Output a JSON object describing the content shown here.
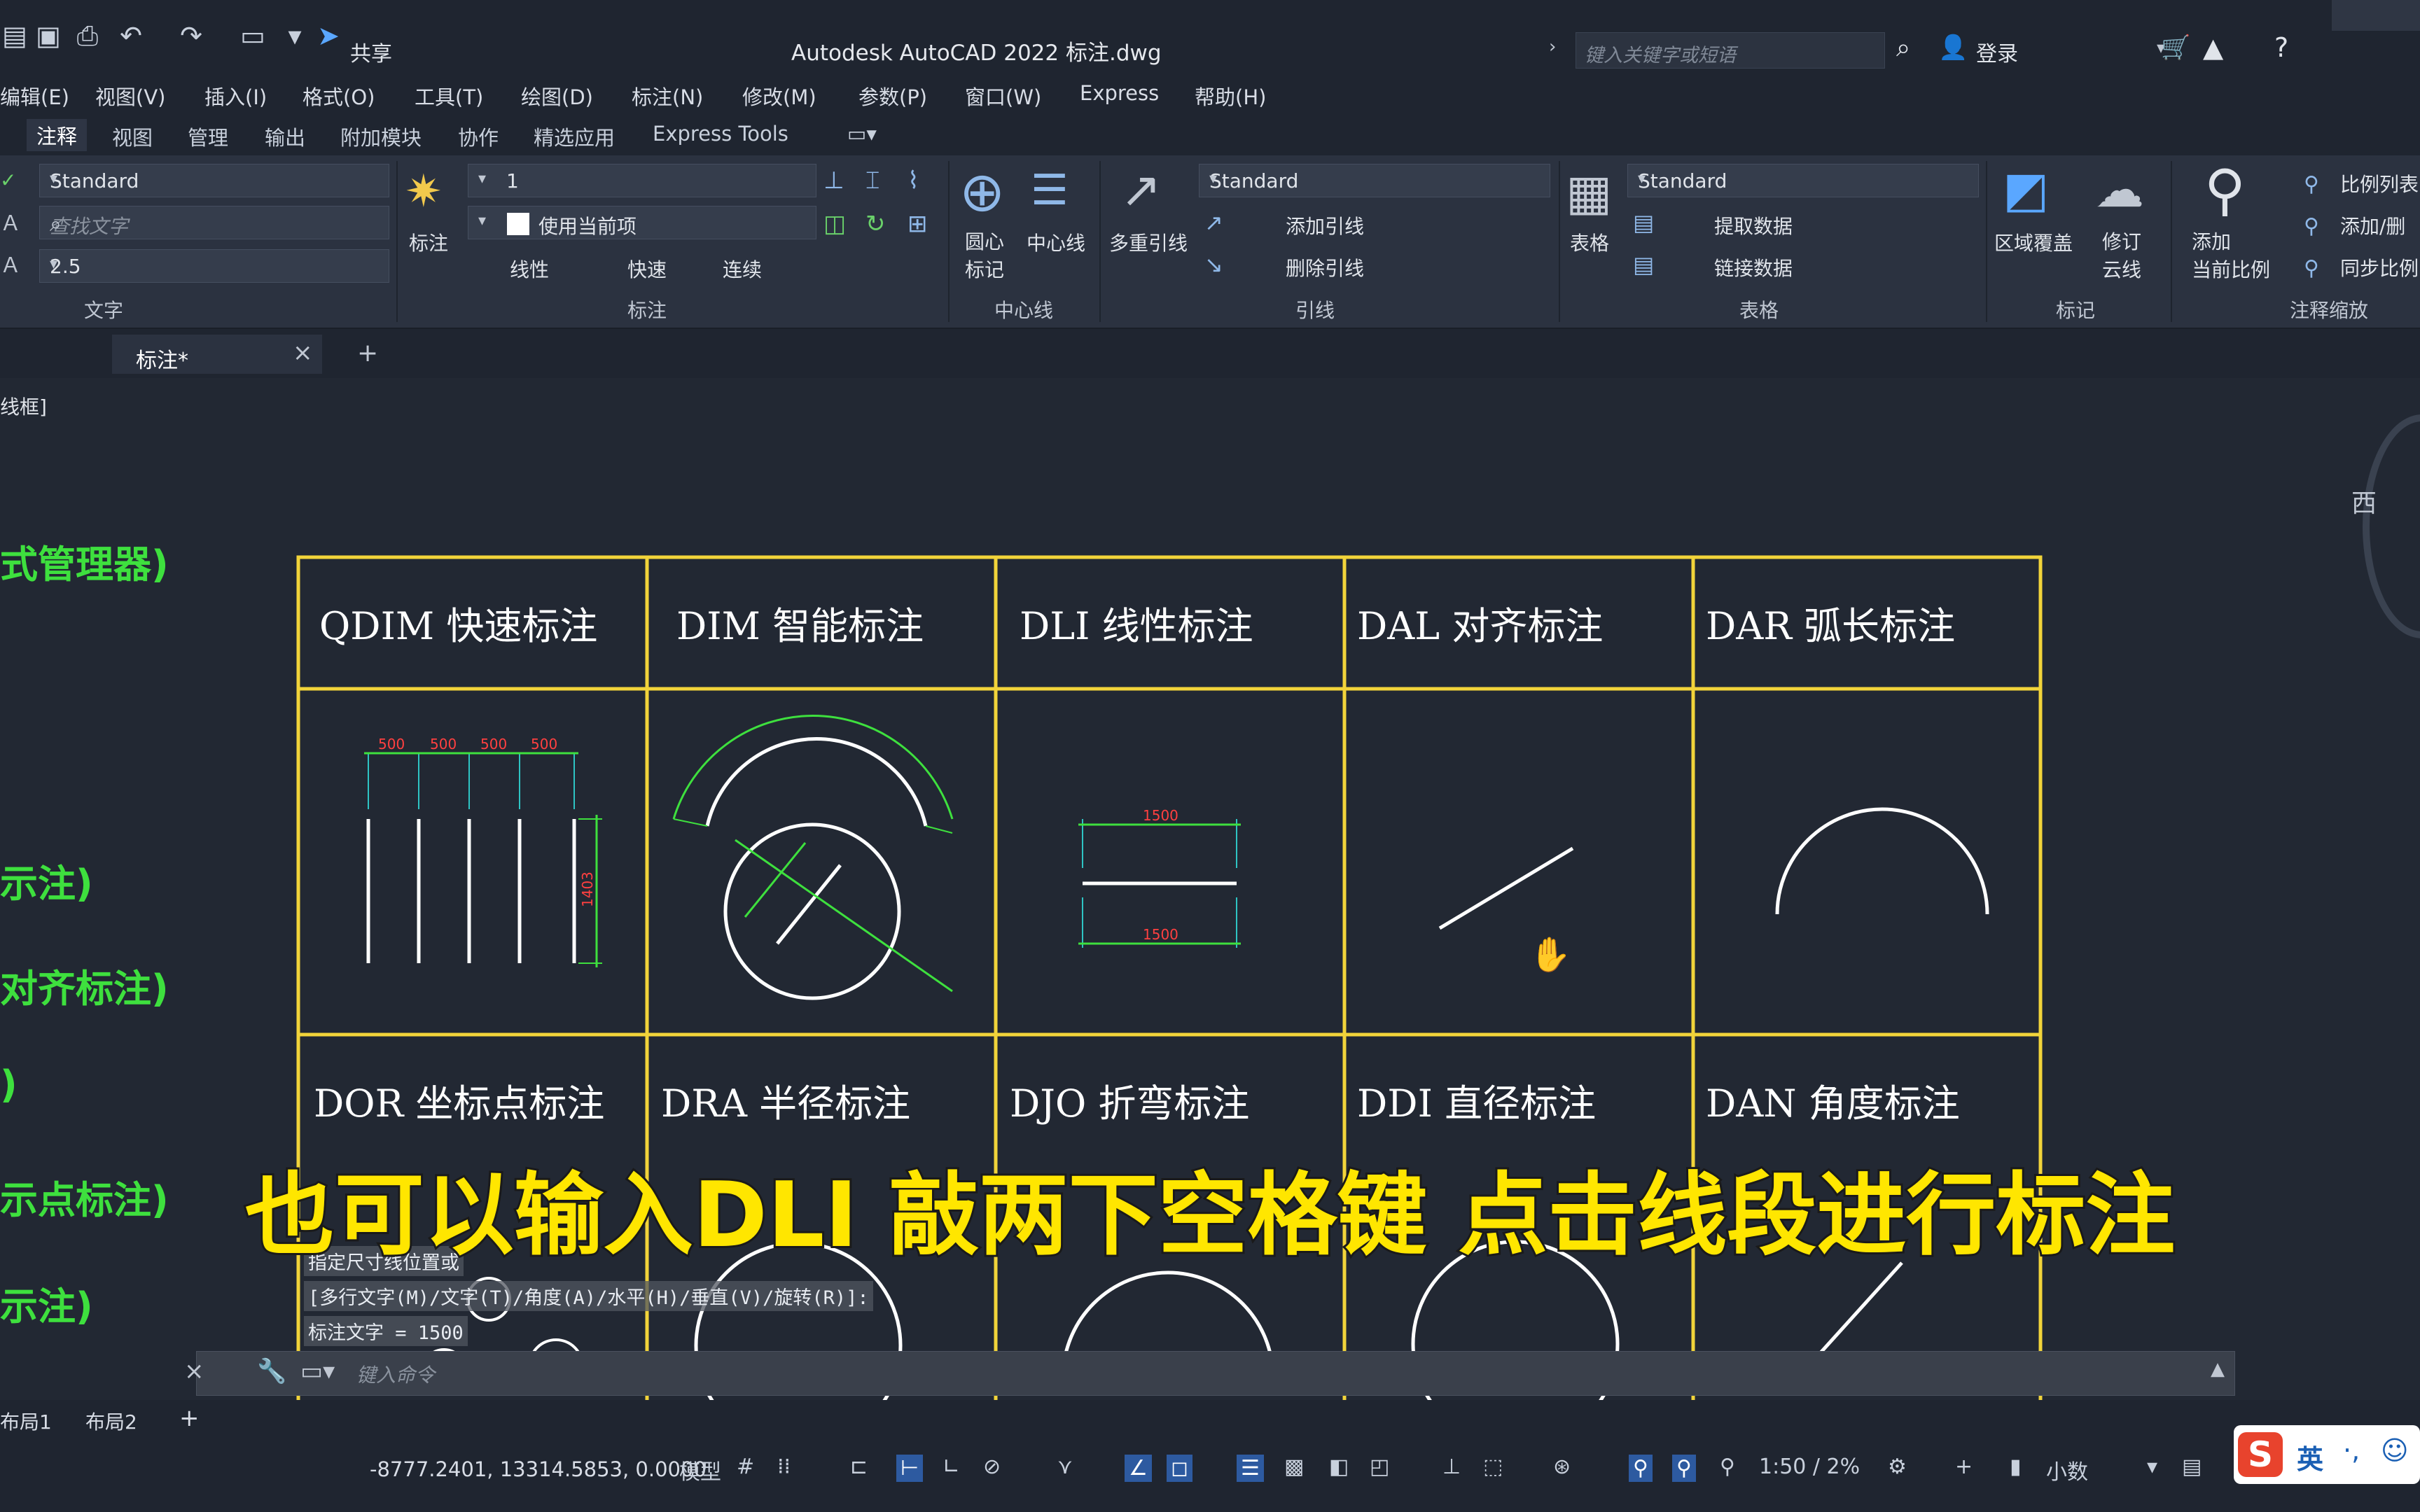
{
  "titlebar": {
    "share": "共享",
    "title": "Autodesk AutoCAD 2022   标注.dwg",
    "search_placeholder": "键入关键字或短语",
    "login": "登录"
  },
  "menu": [
    "编辑(E)",
    "视图(V)",
    "插入(I)",
    "格式(O)",
    "工具(T)",
    "绘图(D)",
    "标注(N)",
    "修改(M)",
    "参数(P)",
    "窗口(W)",
    "Express",
    "帮助(H)"
  ],
  "ribbon_tabs": [
    "注释",
    "视图",
    "管理",
    "输出",
    "附加模块",
    "协作",
    "精选应用",
    "Express Tools"
  ],
  "ribbon": {
    "text_panel": {
      "style": "Standard",
      "find_placeholder": "查找文字",
      "height": "2.5",
      "title": "文字"
    },
    "dim_panel": {
      "dim_label": "标注",
      "dim_style": "1",
      "layer": "使用当前项",
      "linear": "线性",
      "quick": "快速",
      "continue": "连续",
      "title": "标注"
    },
    "center_panel": {
      "center_mark": "圆心\n标记",
      "center_line": "中心线",
      "title": "中心线"
    },
    "leader_panel": {
      "mleader": "多重引线",
      "style": "Standard",
      "add": "添加引线",
      "remove": "删除引线",
      "title": "引线"
    },
    "table_panel": {
      "table": "表格",
      "style": "Standard",
      "extract": "提取数据",
      "link": "链接数据",
      "title": "表格"
    },
    "mark_panel": {
      "wipeout": "区域覆盖",
      "revcloud": "修订\n云线",
      "title": "标记"
    },
    "scale_panel": {
      "add": "添加\n当前比例",
      "list": "比例列表",
      "addremove": "添加/删",
      "sync": "同步比例",
      "title": "注释缩放"
    }
  },
  "doc_tab": "标注*",
  "viewport_label": "线框]",
  "viewcube_west": "西",
  "green_notes": [
    "式管理器)",
    "示注)",
    "对齐标注)",
    ")",
    "示点标注)",
    "示注)"
  ],
  "table_titles_row1": [
    "QDIM 快速标注",
    "DIM 智能标注",
    "DLI 线性标注",
    "DAL 对齐标注",
    "DAR 弧长标注"
  ],
  "table_titles_row2": [
    "DOR 坐标点标注",
    "DRA 半径标注",
    "DJO 折弯标注",
    "DDI 直径标注",
    "DAN 角度标注"
  ],
  "dim_values": {
    "qdim": [
      "500",
      "500",
      "500",
      "500"
    ],
    "qdim_vert": "1403",
    "dli_top": "1500",
    "dli_bottom": "1500"
  },
  "command_history": [
    "指定尺寸线位置或",
    "[多行文字(M)/文字(T)/角度(A)/水平(H)/垂直(V)/旋转(R)]:",
    "标注文字 = 1500"
  ],
  "command_placeholder": "键入命令",
  "subtitle": "也可以输入DLI 敲两下空格键 点击线段进行标注",
  "layout_tabs": [
    "布局1",
    "布局2"
  ],
  "status": {
    "coords": "-8777.2401, 13314.5853, 0.0000",
    "model": "模型",
    "scale": "1:50 / 2%",
    "units": "小数"
  },
  "ime": "英"
}
